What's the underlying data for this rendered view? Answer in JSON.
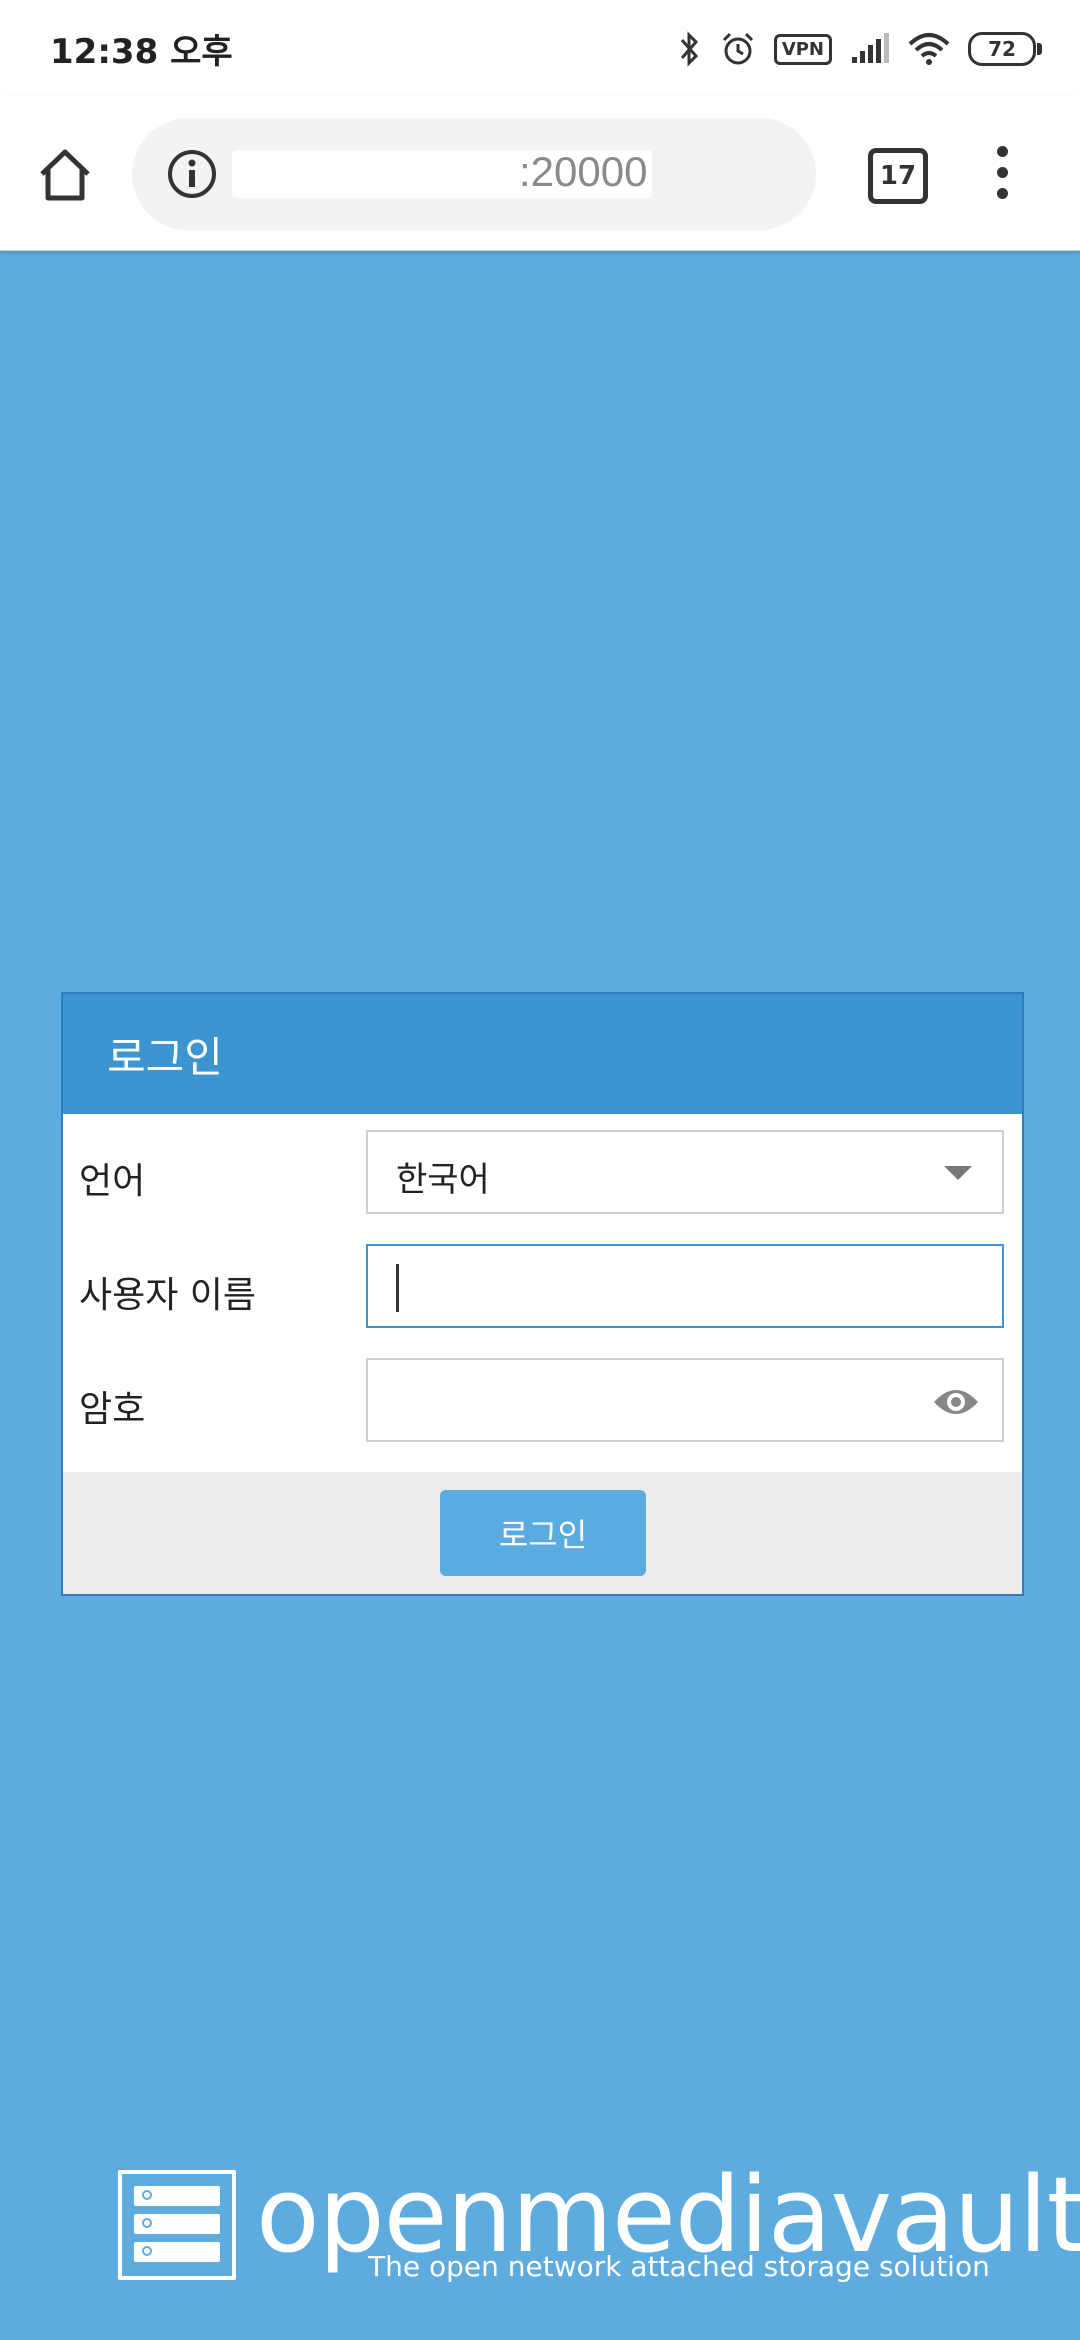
{
  "status_bar": {
    "time": "12:38 오후",
    "vpn_label": "VPN",
    "battery": "72",
    "icons": [
      "bluetooth-icon",
      "alarm-icon",
      "vpn-icon",
      "signal-icon",
      "wifi-icon",
      "battery-icon"
    ]
  },
  "browser": {
    "url_visible": ":20000",
    "tab_count": "17",
    "icons": [
      "home-icon",
      "info-icon",
      "overflow-menu-icon"
    ]
  },
  "login": {
    "title": "로그인",
    "language_label": "언어",
    "language_value": "한국어",
    "username_label": "사용자 이름",
    "username_value": "",
    "password_label": "암호",
    "password_value": "",
    "submit_label": "로그인"
  },
  "branding": {
    "name": "openmediavault",
    "tagline": "The open network attached storage solution"
  },
  "colors": {
    "background": "#5dabdf",
    "header": "#3c94d0",
    "button": "#5aabdf",
    "footer": "#ececec"
  }
}
